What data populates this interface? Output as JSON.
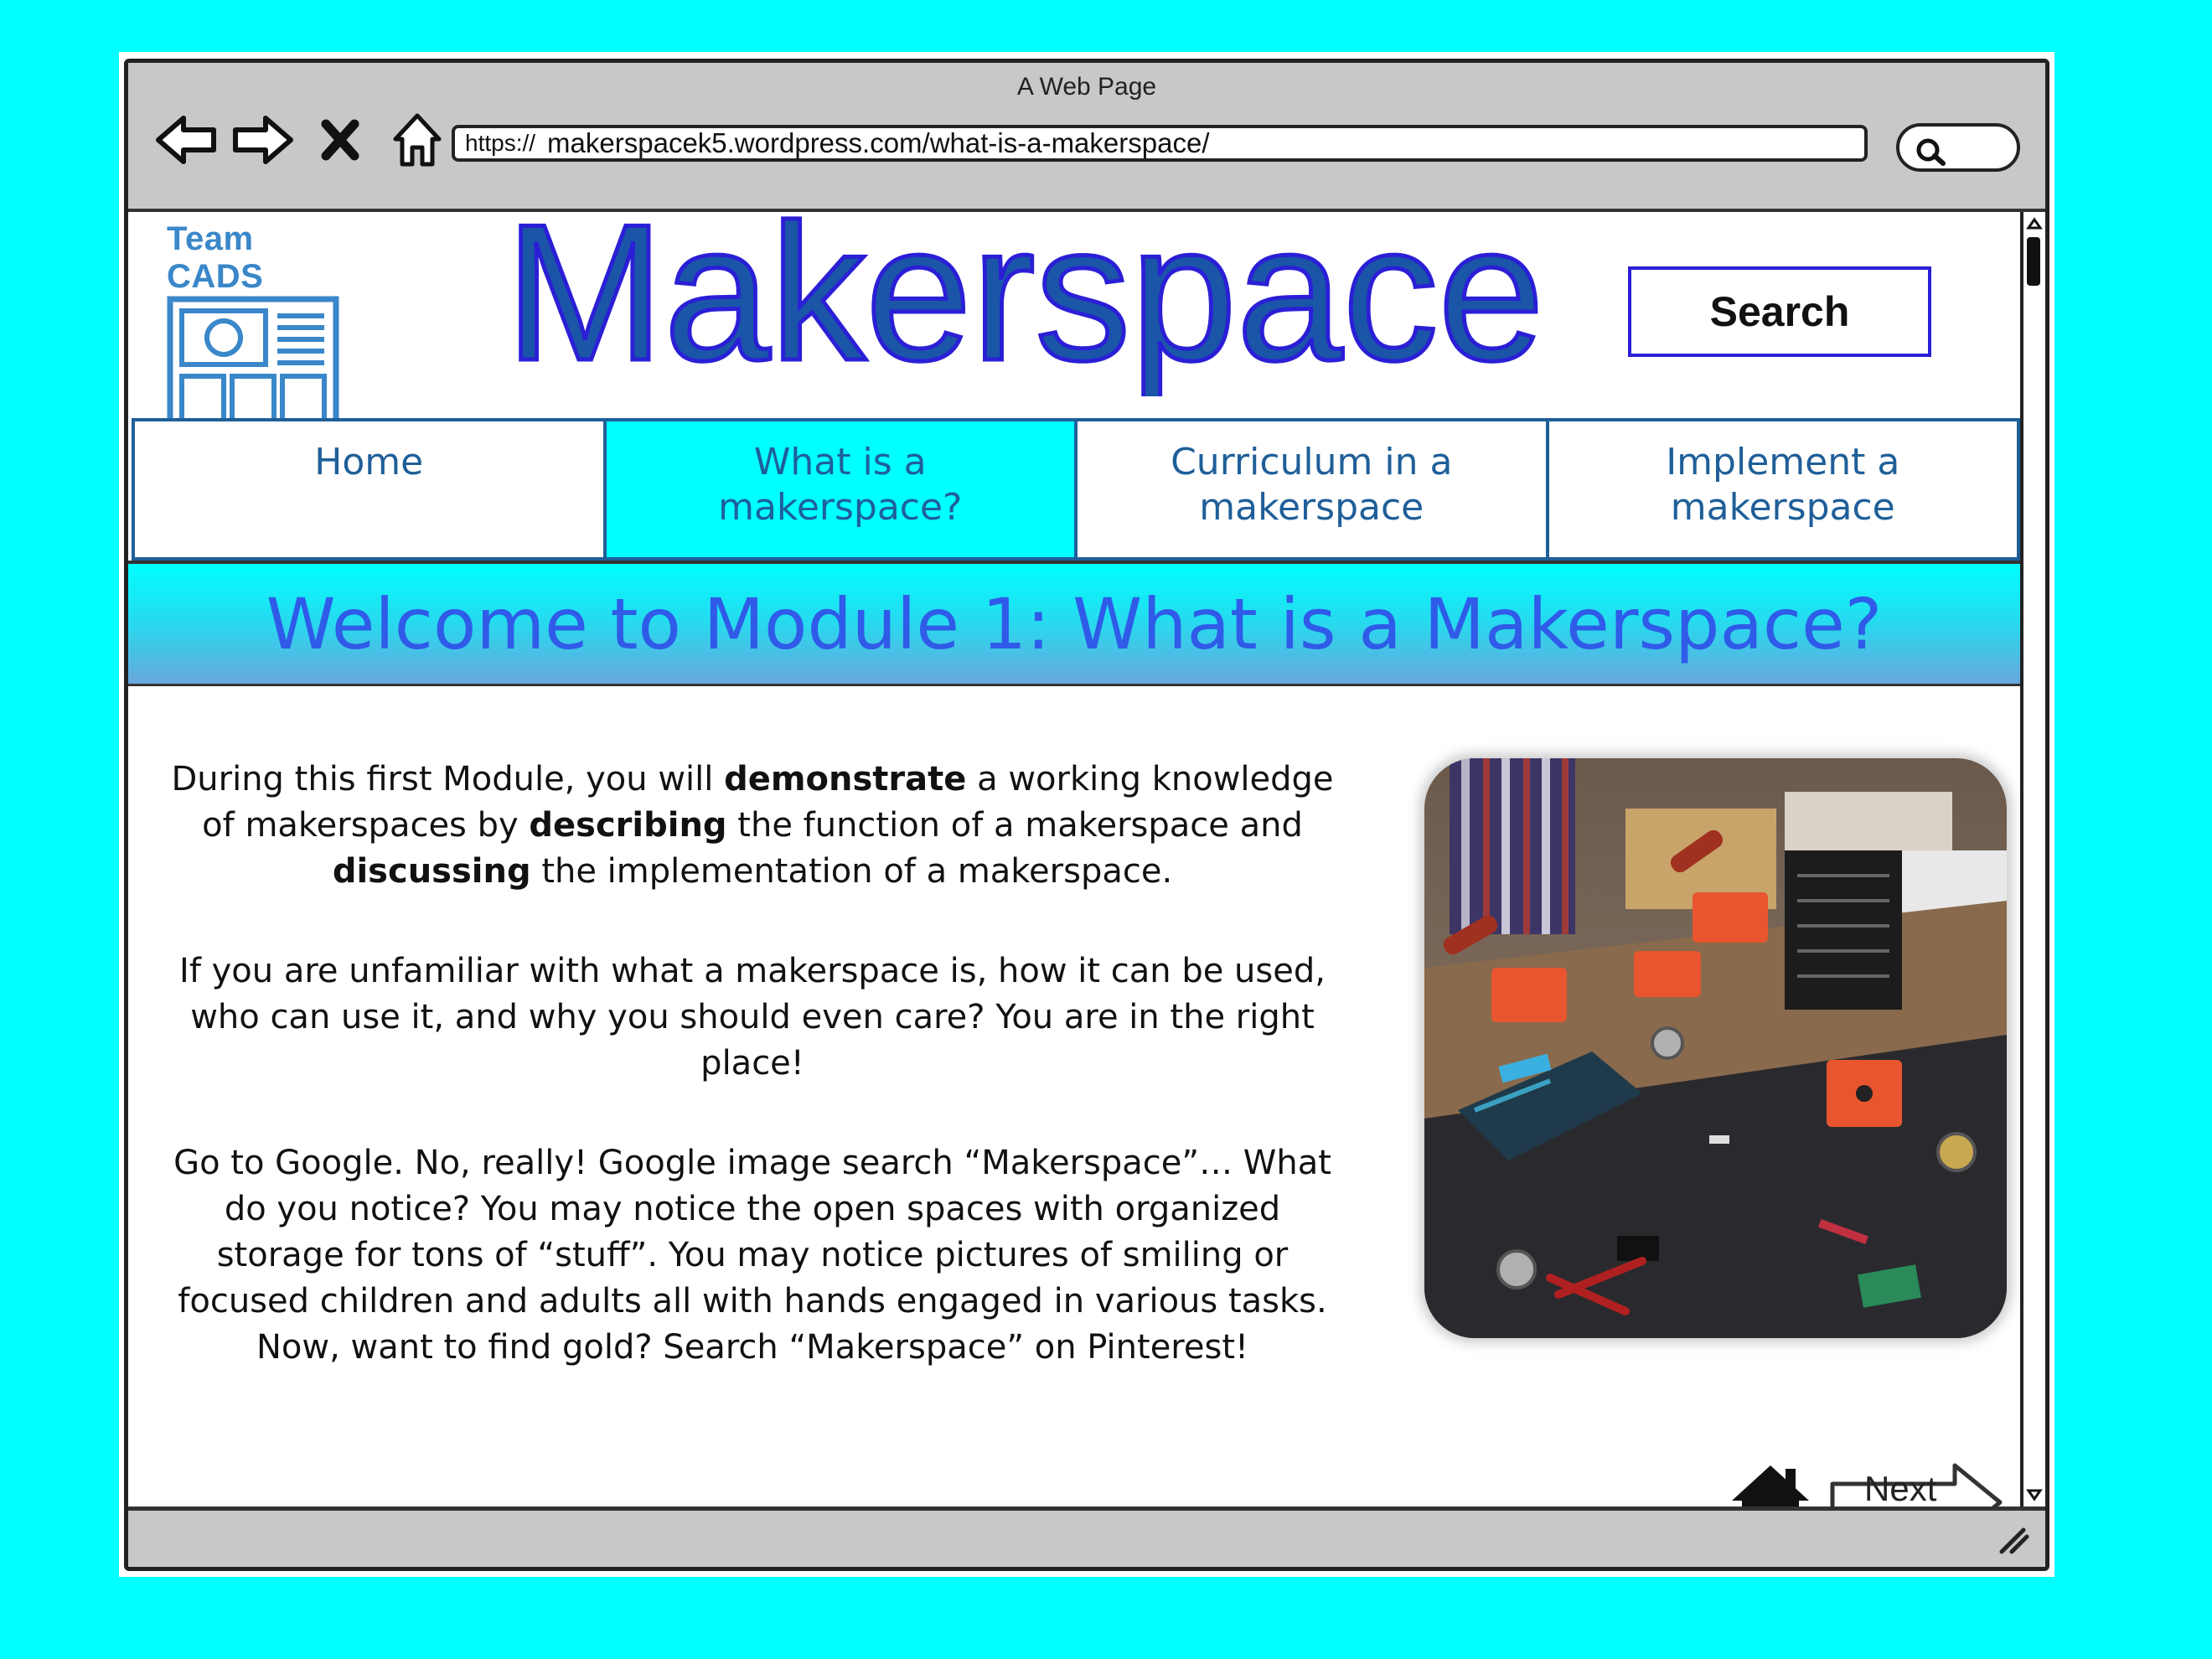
{
  "window": {
    "title": "A Web Page"
  },
  "browser": {
    "url_scheme": "https://",
    "url_rest": "makerspacek5.wordpress.com/what-is-a-makerspace/",
    "icons": [
      "back-arrow-icon",
      "forward-arrow-icon",
      "close-x-icon",
      "home-icon",
      "search-icon"
    ]
  },
  "site": {
    "logo_text": "Team CADS",
    "title": "Makerspace",
    "search_button": "Search",
    "colors": {
      "title_fill": "#1a55a8",
      "title_outline": "#2b1fd6",
      "nav_text": "#1f5f99",
      "active_tab": "#00ffff",
      "banner_text": "#2f5be8",
      "background": "#00ffff"
    }
  },
  "nav": {
    "items": [
      {
        "line1": "Home",
        "line2": ""
      },
      {
        "line1": "What is a",
        "line2": "makerspace?"
      },
      {
        "line1": "Curriculum in a",
        "line2": "makerspace"
      },
      {
        "line1": "Implement a",
        "line2": "makerspace"
      }
    ],
    "active_index": 1
  },
  "banner": {
    "text": "Welcome to Module 1: What is a Makerspace?"
  },
  "content": {
    "p1": {
      "a": "During this first Module, you will ",
      "b": "demonstrate",
      "c": " a working knowledge of makerspaces by ",
      "d": "describing",
      "e": " the function of a makerspace and ",
      "f": "discussing",
      "g": " the implementation of a makerspace."
    },
    "p2": "If you are unfamiliar with what a makerspace is, how it can be used, who can use it, and why you should even care? You are in the right place!",
    "p3": "Go to Google. No, really! Google image search “Makerspace”… What do you notice? You may notice the open spaces with organized storage for tons of “stuff”. You may notice pictures of smiling or focused children and adults all with hands engaged in various tasks.  Now, want to find gold? Search “Makerspace” on Pinterest!"
  },
  "footer_nav": {
    "next_label": "Next"
  }
}
